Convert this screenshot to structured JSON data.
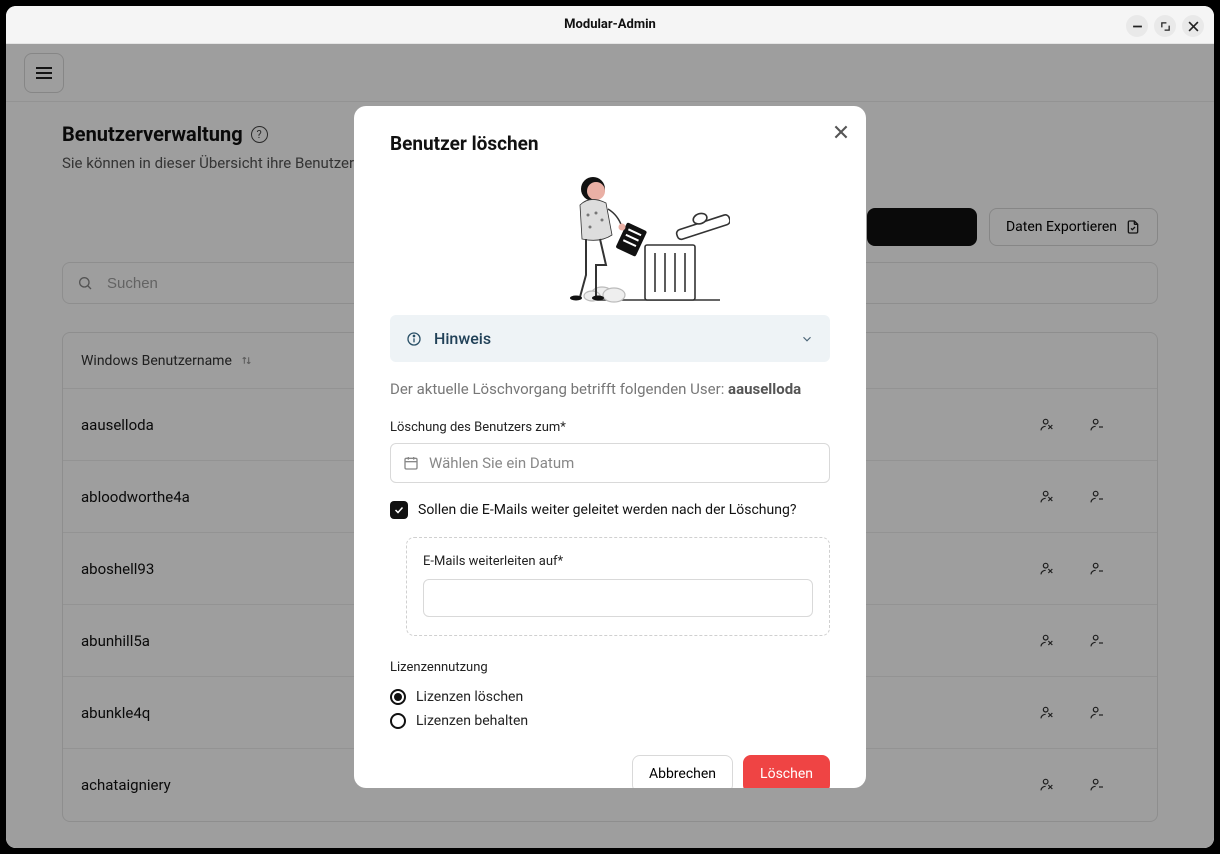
{
  "window": {
    "title": "Modular-Admin"
  },
  "header": {
    "title": "Benutzerverwaltung",
    "subtitle": "Sie können in dieser Übersicht ihre Benutzerk"
  },
  "toolbar": {
    "export_label": "Daten Exportieren"
  },
  "search": {
    "placeholder": "Suchen"
  },
  "table": {
    "column_name": "Windows Benutzername",
    "rows": [
      {
        "name": "aauselloda"
      },
      {
        "name": "abloodworthe4a"
      },
      {
        "name": "aboshell93"
      },
      {
        "name": "abunhill5a"
      },
      {
        "name": "abunkle4q"
      },
      {
        "name": "achataigniery"
      }
    ]
  },
  "modal": {
    "title": "Benutzer löschen",
    "hint_label": "Hinweis",
    "prefix_text": "Der aktuelle Löschvorgang betrifft folgenden User: ",
    "user": "aauselloda",
    "date_label": "Löschung des Benutzers zum*",
    "date_placeholder": "Wählen Sie ein Datum",
    "forward_checkbox_label": "Sollen die E-Mails weiter geleitet werden nach der Löschung?",
    "forward_target_label": "E-Mails weiterleiten auf*",
    "license_heading": "Lizenzennutzung",
    "license_opt_delete": "Lizenzen löschen",
    "license_opt_keep": "Lizenzen behalten",
    "actions": {
      "cancel": "Abbrechen",
      "delete": "Löschen"
    }
  }
}
